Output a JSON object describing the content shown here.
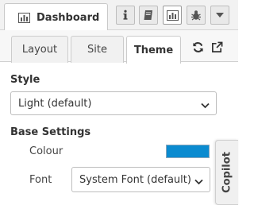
{
  "header": {
    "dashboard_tab_label": "Dashboard",
    "buttons": [
      {
        "icon": "info-icon"
      },
      {
        "icon": "book-icon"
      },
      {
        "icon": "chart-icon",
        "active": true
      },
      {
        "icon": "bug-icon"
      },
      {
        "icon": "caret-down-icon"
      }
    ]
  },
  "subtabs": {
    "items": [
      {
        "label": "Layout"
      },
      {
        "label": "Site"
      },
      {
        "label": "Theme",
        "active": true
      }
    ],
    "icons": [
      "refresh-icon",
      "external-link-icon"
    ]
  },
  "style": {
    "label": "Style",
    "selected": "Light (default)"
  },
  "base_settings": {
    "label": "Base Settings",
    "colour_label": "Colour",
    "colour_value": "#0b8bd0",
    "font_label": "Font",
    "font_selected": "System Font (default)"
  },
  "copilot": {
    "label": "Copilot"
  }
}
